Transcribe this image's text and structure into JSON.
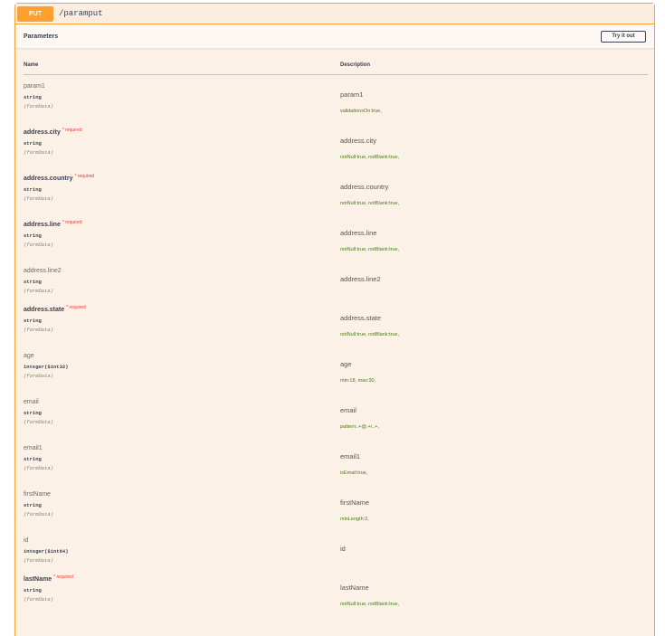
{
  "operation": {
    "method": "PUT",
    "path": "/paramput",
    "section_title": "Parameters",
    "try_button": "Try it out"
  },
  "table": {
    "col_name": "Name",
    "col_description": "Description"
  },
  "params": [
    {
      "name": "param1",
      "required": false,
      "type": "string",
      "in": "(formData)",
      "description": "param1",
      "validations": "validationsOn:true,"
    },
    {
      "name": "address.city",
      "required": true,
      "type": "string",
      "in": "(formData)",
      "description": "address.city",
      "validations": "notNull:true, notBlank:true,"
    },
    {
      "name": "address.country",
      "required": true,
      "type": "string",
      "in": "(formData)",
      "description": "address.country",
      "validations": "notNull:true, notBlank:true,"
    },
    {
      "name": "address.line",
      "required": true,
      "type": "string",
      "in": "(formData)",
      "description": "address.line",
      "validations": "notNull:true, notBlank:true,"
    },
    {
      "name": "address.line2",
      "required": false,
      "type": "string",
      "in": "(formData)",
      "description": "address.line2",
      "validations": ""
    },
    {
      "name": "address.state",
      "required": true,
      "type": "string",
      "in": "(formData)",
      "description": "address.state",
      "validations": "notNull:true, notBlank:true,"
    },
    {
      "name": "age",
      "required": false,
      "type": "integer($int32)",
      "in": "(formData)",
      "description": "age",
      "validations": "min:18, max:30,"
    },
    {
      "name": "email",
      "required": false,
      "type": "string",
      "in": "(formData)",
      "description": "email",
      "validations": "pattern:.+@.+\\..+,"
    },
    {
      "name": "email1",
      "required": false,
      "type": "string",
      "in": "(formData)",
      "description": "email1",
      "validations": "isEmail:true,"
    },
    {
      "name": "firstName",
      "required": false,
      "type": "string",
      "in": "(formData)",
      "description": "firstName",
      "validations": "minLength:2,"
    },
    {
      "name": "id",
      "required": false,
      "type": "integer($int64)",
      "in": "(formData)",
      "description": "id",
      "validations": ""
    },
    {
      "name": "lastName",
      "required": true,
      "type": "string",
      "in": "(formData)",
      "description": "lastName",
      "validations": "notNull:true, notBlank:true,"
    }
  ],
  "required_marker": "* required",
  "colors": {
    "put_accent": "#fca130",
    "block_background": "#fcf1e6",
    "required": "#e53935",
    "validation_text": "#49781f"
  }
}
